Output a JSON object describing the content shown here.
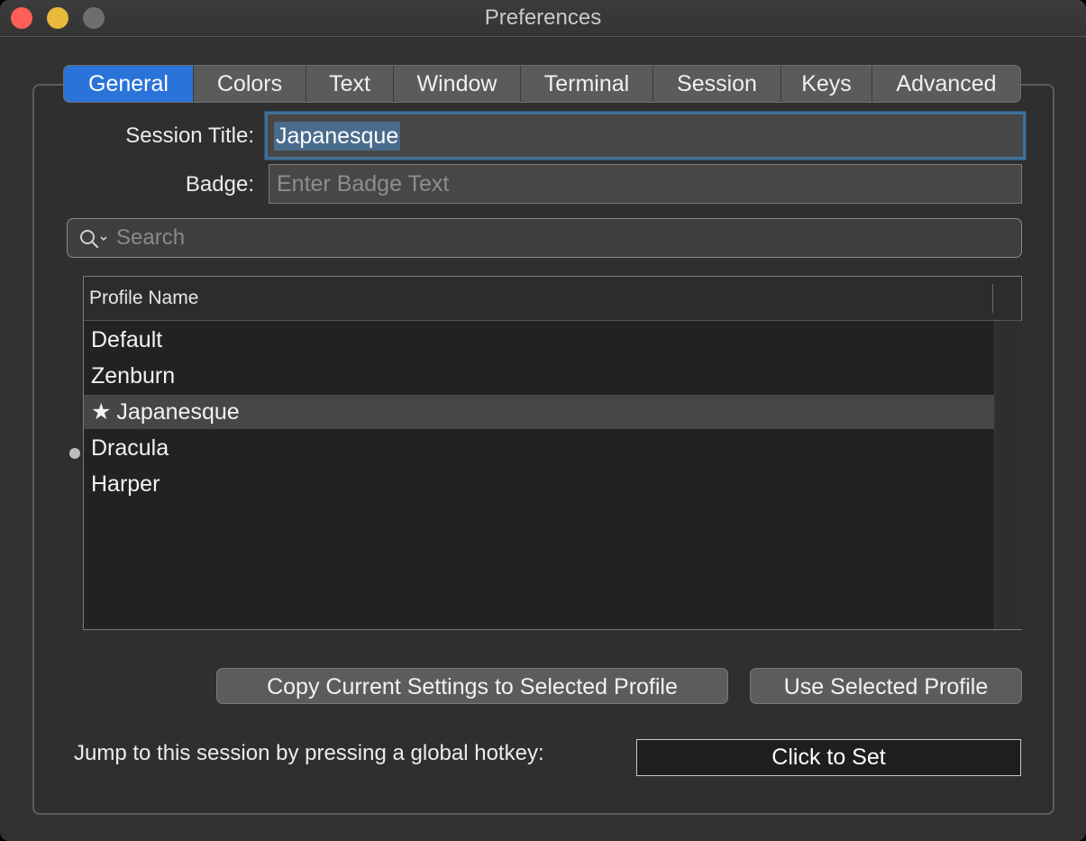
{
  "window": {
    "title": "Preferences"
  },
  "tabs": [
    {
      "label": "General"
    },
    {
      "label": "Colors"
    },
    {
      "label": "Text"
    },
    {
      "label": "Window"
    },
    {
      "label": "Terminal"
    },
    {
      "label": "Session"
    },
    {
      "label": "Keys"
    },
    {
      "label": "Advanced"
    }
  ],
  "session_title": {
    "label": "Session Title:",
    "value": "Japanesque"
  },
  "badge": {
    "label": "Badge:",
    "placeholder": "Enter Badge Text"
  },
  "search": {
    "placeholder": "Search"
  },
  "profiles": {
    "column_header": "Profile Name",
    "items": [
      {
        "name": "Default"
      },
      {
        "name": "Zenburn"
      },
      {
        "name": "Japanesque",
        "selected": true,
        "icon": "star-icon",
        "glyph": "★"
      },
      {
        "name": "Dracula"
      },
      {
        "name": "Harper"
      }
    ]
  },
  "buttons": {
    "copy_settings": "Copy Current Settings to Selected Profile",
    "use_selected": "Use Selected Profile"
  },
  "hotkey": {
    "label": "Jump to this session by pressing a global hotkey:",
    "button": "Click to Set"
  },
  "colors": {
    "accent": "#2a73d9",
    "selection": "#4a6c8c"
  }
}
